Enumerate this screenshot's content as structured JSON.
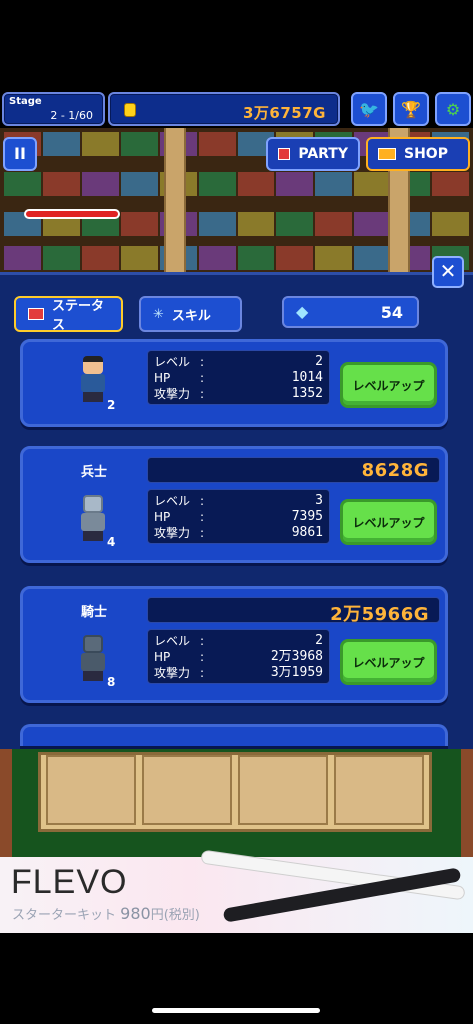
{
  "hud": {
    "stage_label": "Stage",
    "stage_value": "2 - 1/60",
    "gold": "3万6757G",
    "twitter_icon": "twitter-icon",
    "trophy_icon": "trophy-icon",
    "settings_icon": "gear-icon"
  },
  "buttons": {
    "pause": "II",
    "party": "PARTY",
    "shop": "SHOP",
    "close": "✕"
  },
  "tabs": {
    "status": "ステータス",
    "skill": "スキル",
    "gems": "54"
  },
  "units": [
    {
      "name": "",
      "cost": "",
      "count": "2",
      "level_label": "レベル",
      "level": "2",
      "hp_label": "HP",
      "hp": "1014",
      "atk_label": "攻撃力",
      "atk": "1352",
      "button": "レベルアップ"
    },
    {
      "name": "兵士",
      "cost": "8628G",
      "count": "4",
      "level_label": "レベル",
      "level": "3",
      "hp_label": "HP",
      "hp": "7395",
      "atk_label": "攻撃力",
      "atk": "9861",
      "button": "レベルアップ"
    },
    {
      "name": "騎士",
      "cost": "2万5966G",
      "count": "8",
      "level_label": "レベル",
      "level": "2",
      "hp_label": "HP",
      "hp": "2万3968",
      "atk_label": "攻撃力",
      "atk": "3万1959",
      "button": "レベルアップ"
    }
  ],
  "ad": {
    "brand": "FLEVO",
    "subtitle": "スターターキット",
    "price": "980",
    "price_suffix": "円(税別)"
  },
  "colors": {
    "panel": "#10286e",
    "card": "#1a47c8",
    "gold_text": "#ffb43a",
    "levelup_green": "#66e04a"
  }
}
